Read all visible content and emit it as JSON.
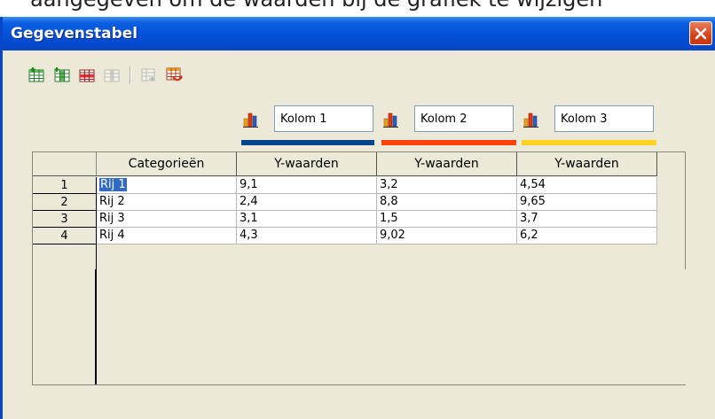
{
  "background_caption": "aangegeven om de waarden bij de grafiek te wijzigen",
  "window": {
    "title": "Gegevenstabel",
    "close_icon": "close-x-icon"
  },
  "toolbar": {
    "buttons": [
      {
        "name": "insert-row-icon",
        "enabled": true
      },
      {
        "name": "insert-series-icon",
        "enabled": true
      },
      {
        "name": "delete-row-icon",
        "enabled": true
      },
      {
        "name": "delete-series-icon",
        "enabled": false
      },
      {
        "name": "move-series-icon",
        "enabled": false
      },
      {
        "name": "swap-row-icon",
        "enabled": true
      }
    ]
  },
  "series": [
    {
      "name": "Kolom 1",
      "color": "#00468b"
    },
    {
      "name": "Kolom 2",
      "color": "#ff420e"
    },
    {
      "name": "Kolom 3",
      "color": "#ffd320"
    }
  ],
  "table": {
    "headers": [
      "Categorieën",
      "Y-waarden",
      "Y-waarden",
      "Y-waarden"
    ],
    "rows": [
      {
        "num": "1",
        "cells": [
          "Rij 1",
          "9,1",
          "3,2",
          "4,54"
        ]
      },
      {
        "num": "2",
        "cells": [
          "Rij 2",
          "2,4",
          "8,8",
          "9,65"
        ]
      },
      {
        "num": "3",
        "cells": [
          "Rij 3",
          "3,1",
          "1,5",
          "3,7"
        ]
      },
      {
        "num": "4",
        "cells": [
          "Rij 4",
          "4,3",
          "9,02",
          "6,2"
        ]
      }
    ]
  },
  "colors": {
    "titlebar": "#0350d8",
    "dialog_bg": "#ece9d8",
    "selection": "#316ac5"
  }
}
